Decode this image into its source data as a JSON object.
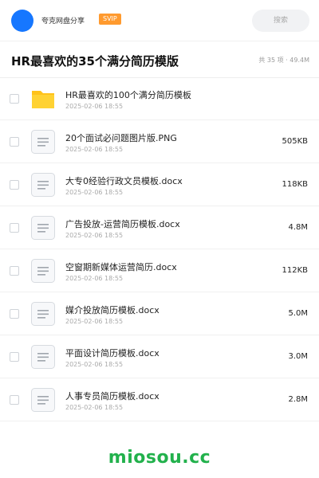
{
  "header": {
    "app_name": "夸克网盘分享",
    "badge": "SVIP",
    "search_placeholder": "搜索",
    "accent_color": "#1677ff",
    "badge_color": "#ff9a2e"
  },
  "share": {
    "title": "HR最喜欢的35个满分简历模版",
    "meta": "共 35 项 · 49.4M"
  },
  "files": [
    {
      "name": "HR最喜欢的100个满分简历模板",
      "date": "2025-02-06 18:55",
      "size": "",
      "icon": "folder-icon"
    },
    {
      "name": "20个面试必问题图片版.PNG",
      "date": "2025-02-06 18:55",
      "size": "505KB",
      "icon": "document-icon"
    },
    {
      "name": "大专0经验行政文员模板.docx",
      "date": "2025-02-06 18:55",
      "size": "118KB",
      "icon": "document-icon"
    },
    {
      "name": "广告投放-运营简历模板.docx",
      "date": "2025-02-06 18:55",
      "size": "4.8M",
      "icon": "document-icon"
    },
    {
      "name": "空窗期新媒体运营简历.docx",
      "date": "2025-02-06 18:55",
      "size": "112KB",
      "icon": "document-icon"
    },
    {
      "name": "媒介投放简历模板.docx",
      "date": "2025-02-06 18:55",
      "size": "5.0M",
      "icon": "document-icon"
    },
    {
      "name": "平面设计简历模板.docx",
      "date": "2025-02-06 18:55",
      "size": "3.0M",
      "icon": "document-icon"
    },
    {
      "name": "人事专员简历模板.docx",
      "date": "2025-02-06 18:55",
      "size": "2.8M",
      "icon": "document-icon"
    }
  ],
  "watermark": "miosou.cc",
  "watermark_color": "#22b14c"
}
